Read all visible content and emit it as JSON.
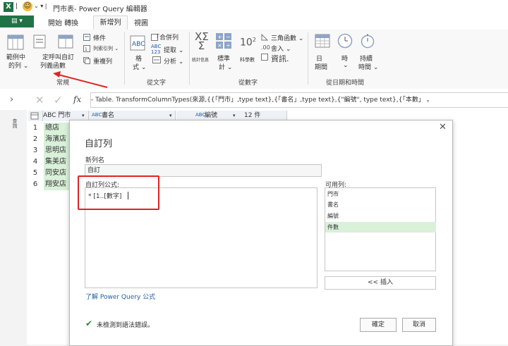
{
  "window": {
    "title": "門市表- Power Query 編輯器",
    "app_icon": "X"
  },
  "tabs": {
    "file": "▤ ▾",
    "home": "開始 轉換",
    "add_column": "新增列",
    "view": "視圖"
  },
  "ribbon": {
    "example_col": [
      "範例中",
      "的列 ⌄"
    ],
    "custom_fn": [
      "定呼叫自訂",
      "列義函數"
    ],
    "conditional": "條件",
    "index": "列索引列 ⌄",
    "duplicate": "重複列",
    "group_general": "常規",
    "merge": "「合併列",
    "format": [
      "格",
      "式 ⌄"
    ],
    "extract": "提取 ⌄",
    "parse": "分析 ⌄",
    "group_text": "從文字",
    "statistics": "統計信息",
    "standard": [
      "標準",
      "計 ⌄"
    ],
    "scientific": "科學數",
    "trig": "三角函數 ⌄",
    "rounding": "舍入 ⌄",
    "info": "資訊.",
    "group_number": "從數字",
    "date": [
      "日",
      "期間"
    ],
    "time": [
      "時",
      "⌄"
    ],
    "duration": [
      "持續",
      "時間 ⌄"
    ],
    "group_datetime": "從日期和時間"
  },
  "formula_bar": {
    "fx": "fx",
    "formula": "- Table. TransformColumnTypes(來源,{{「門市」,type text},{「書名」,type text},{\"編號\", type text},{「本數」 。"
  },
  "query_pane": {
    "label": "查詢"
  },
  "grid": {
    "headers": [
      "ABC 門市",
      "書名",
      "編號",
      "12 件"
    ],
    "rows": [
      {
        "num": "1",
        "store": "總店"
      },
      {
        "num": "2",
        "store": "海濱店"
      },
      {
        "num": "3",
        "store": "思明店"
      },
      {
        "num": "4",
        "store": "集美店"
      },
      {
        "num": "5",
        "store": "同安店"
      },
      {
        "num": "6",
        "store": "翔安店"
      }
    ]
  },
  "dialog": {
    "title": "自訂列",
    "new_col_label": "新列名",
    "new_col_value": "自訂",
    "formula_label": "自訂列公式:",
    "formula_value": "* [1..[數字]",
    "available_label": "可用列:",
    "available": [
      "門市",
      "書名",
      "編號",
      "件數"
    ],
    "selected_index": 3,
    "insert": "<< 插入",
    "learn_link": "了解 Power Query 公式",
    "status": "未檢測到語法錯誤。",
    "ok": "確定",
    "cancel": "取消"
  },
  "colors": {
    "accent": "#217346",
    "highlight": "#e02424",
    "selected": "#d9f0d9",
    "link": "#1f5fa8"
  }
}
